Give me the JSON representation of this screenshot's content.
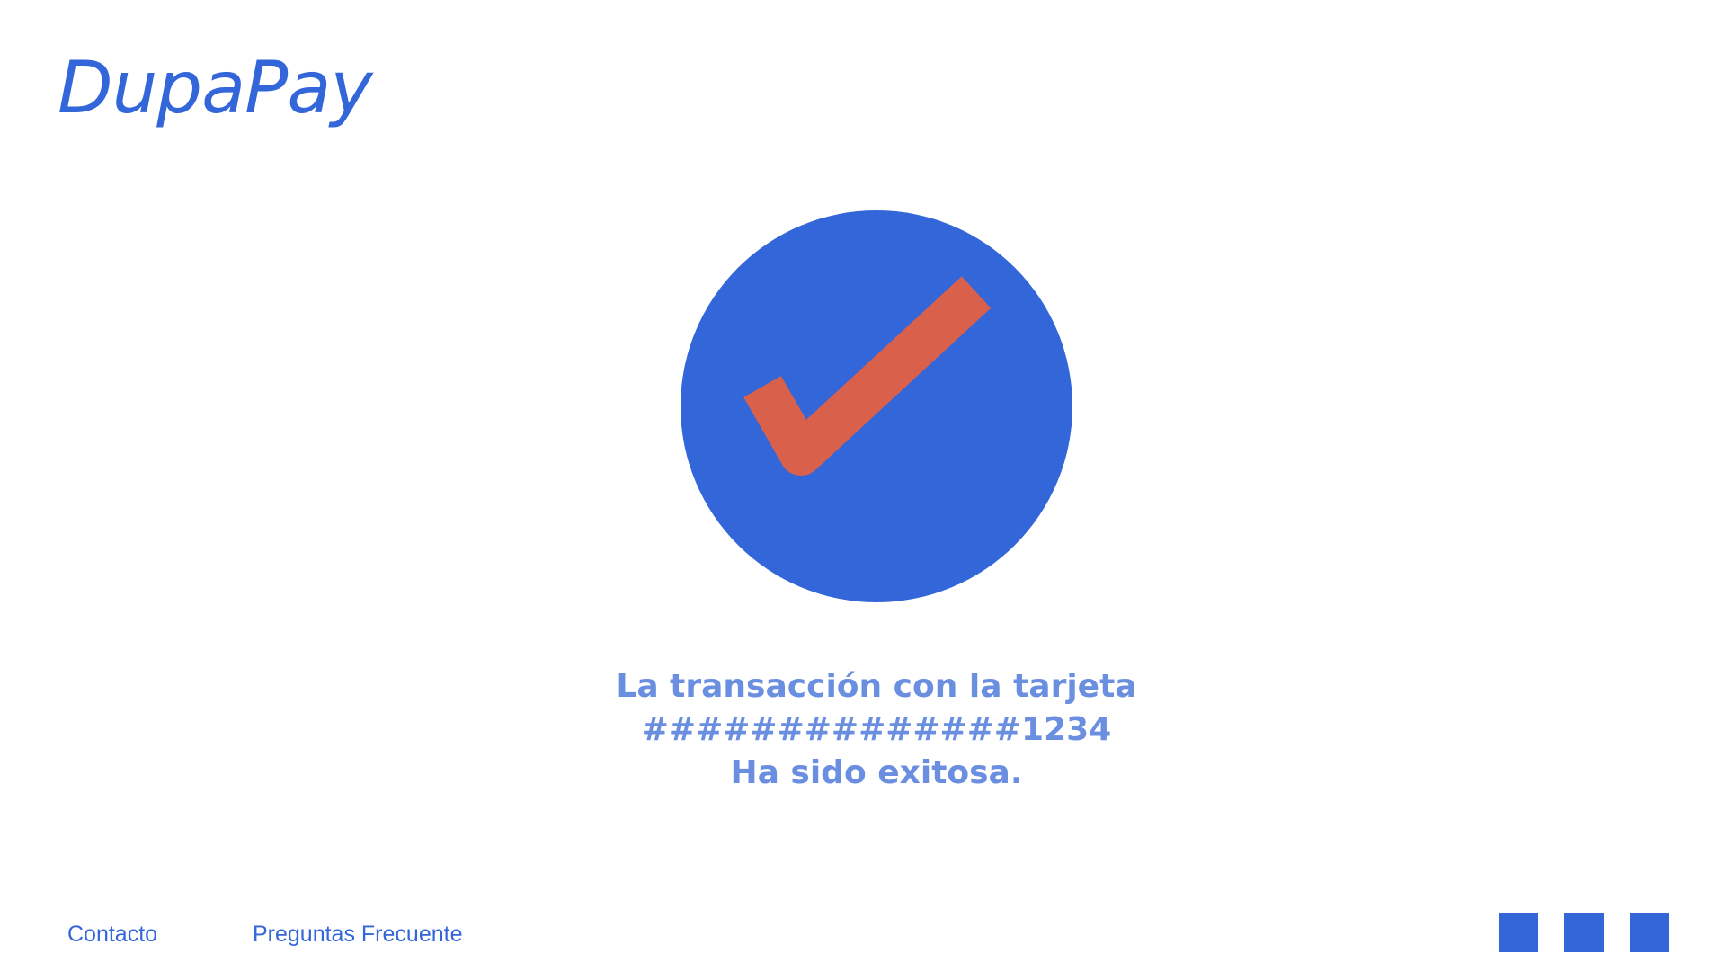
{
  "brand": {
    "name": "DupaPay",
    "color": "#3366d9"
  },
  "status": {
    "icon": "check-circle-icon",
    "circle_color": "#3366d9",
    "check_color": "#d9604a"
  },
  "message": {
    "line1": "La transacción con la tarjeta",
    "line2": "##############1234",
    "line3": "Ha sido exitosa.",
    "color": "#6a8fe0"
  },
  "footer": {
    "links": [
      {
        "label": "Contacto"
      },
      {
        "label": "Preguntas Frecuente"
      }
    ],
    "square_buttons": [
      {
        "icon": "square-icon"
      },
      {
        "icon": "square-icon"
      },
      {
        "icon": "square-icon"
      }
    ]
  }
}
